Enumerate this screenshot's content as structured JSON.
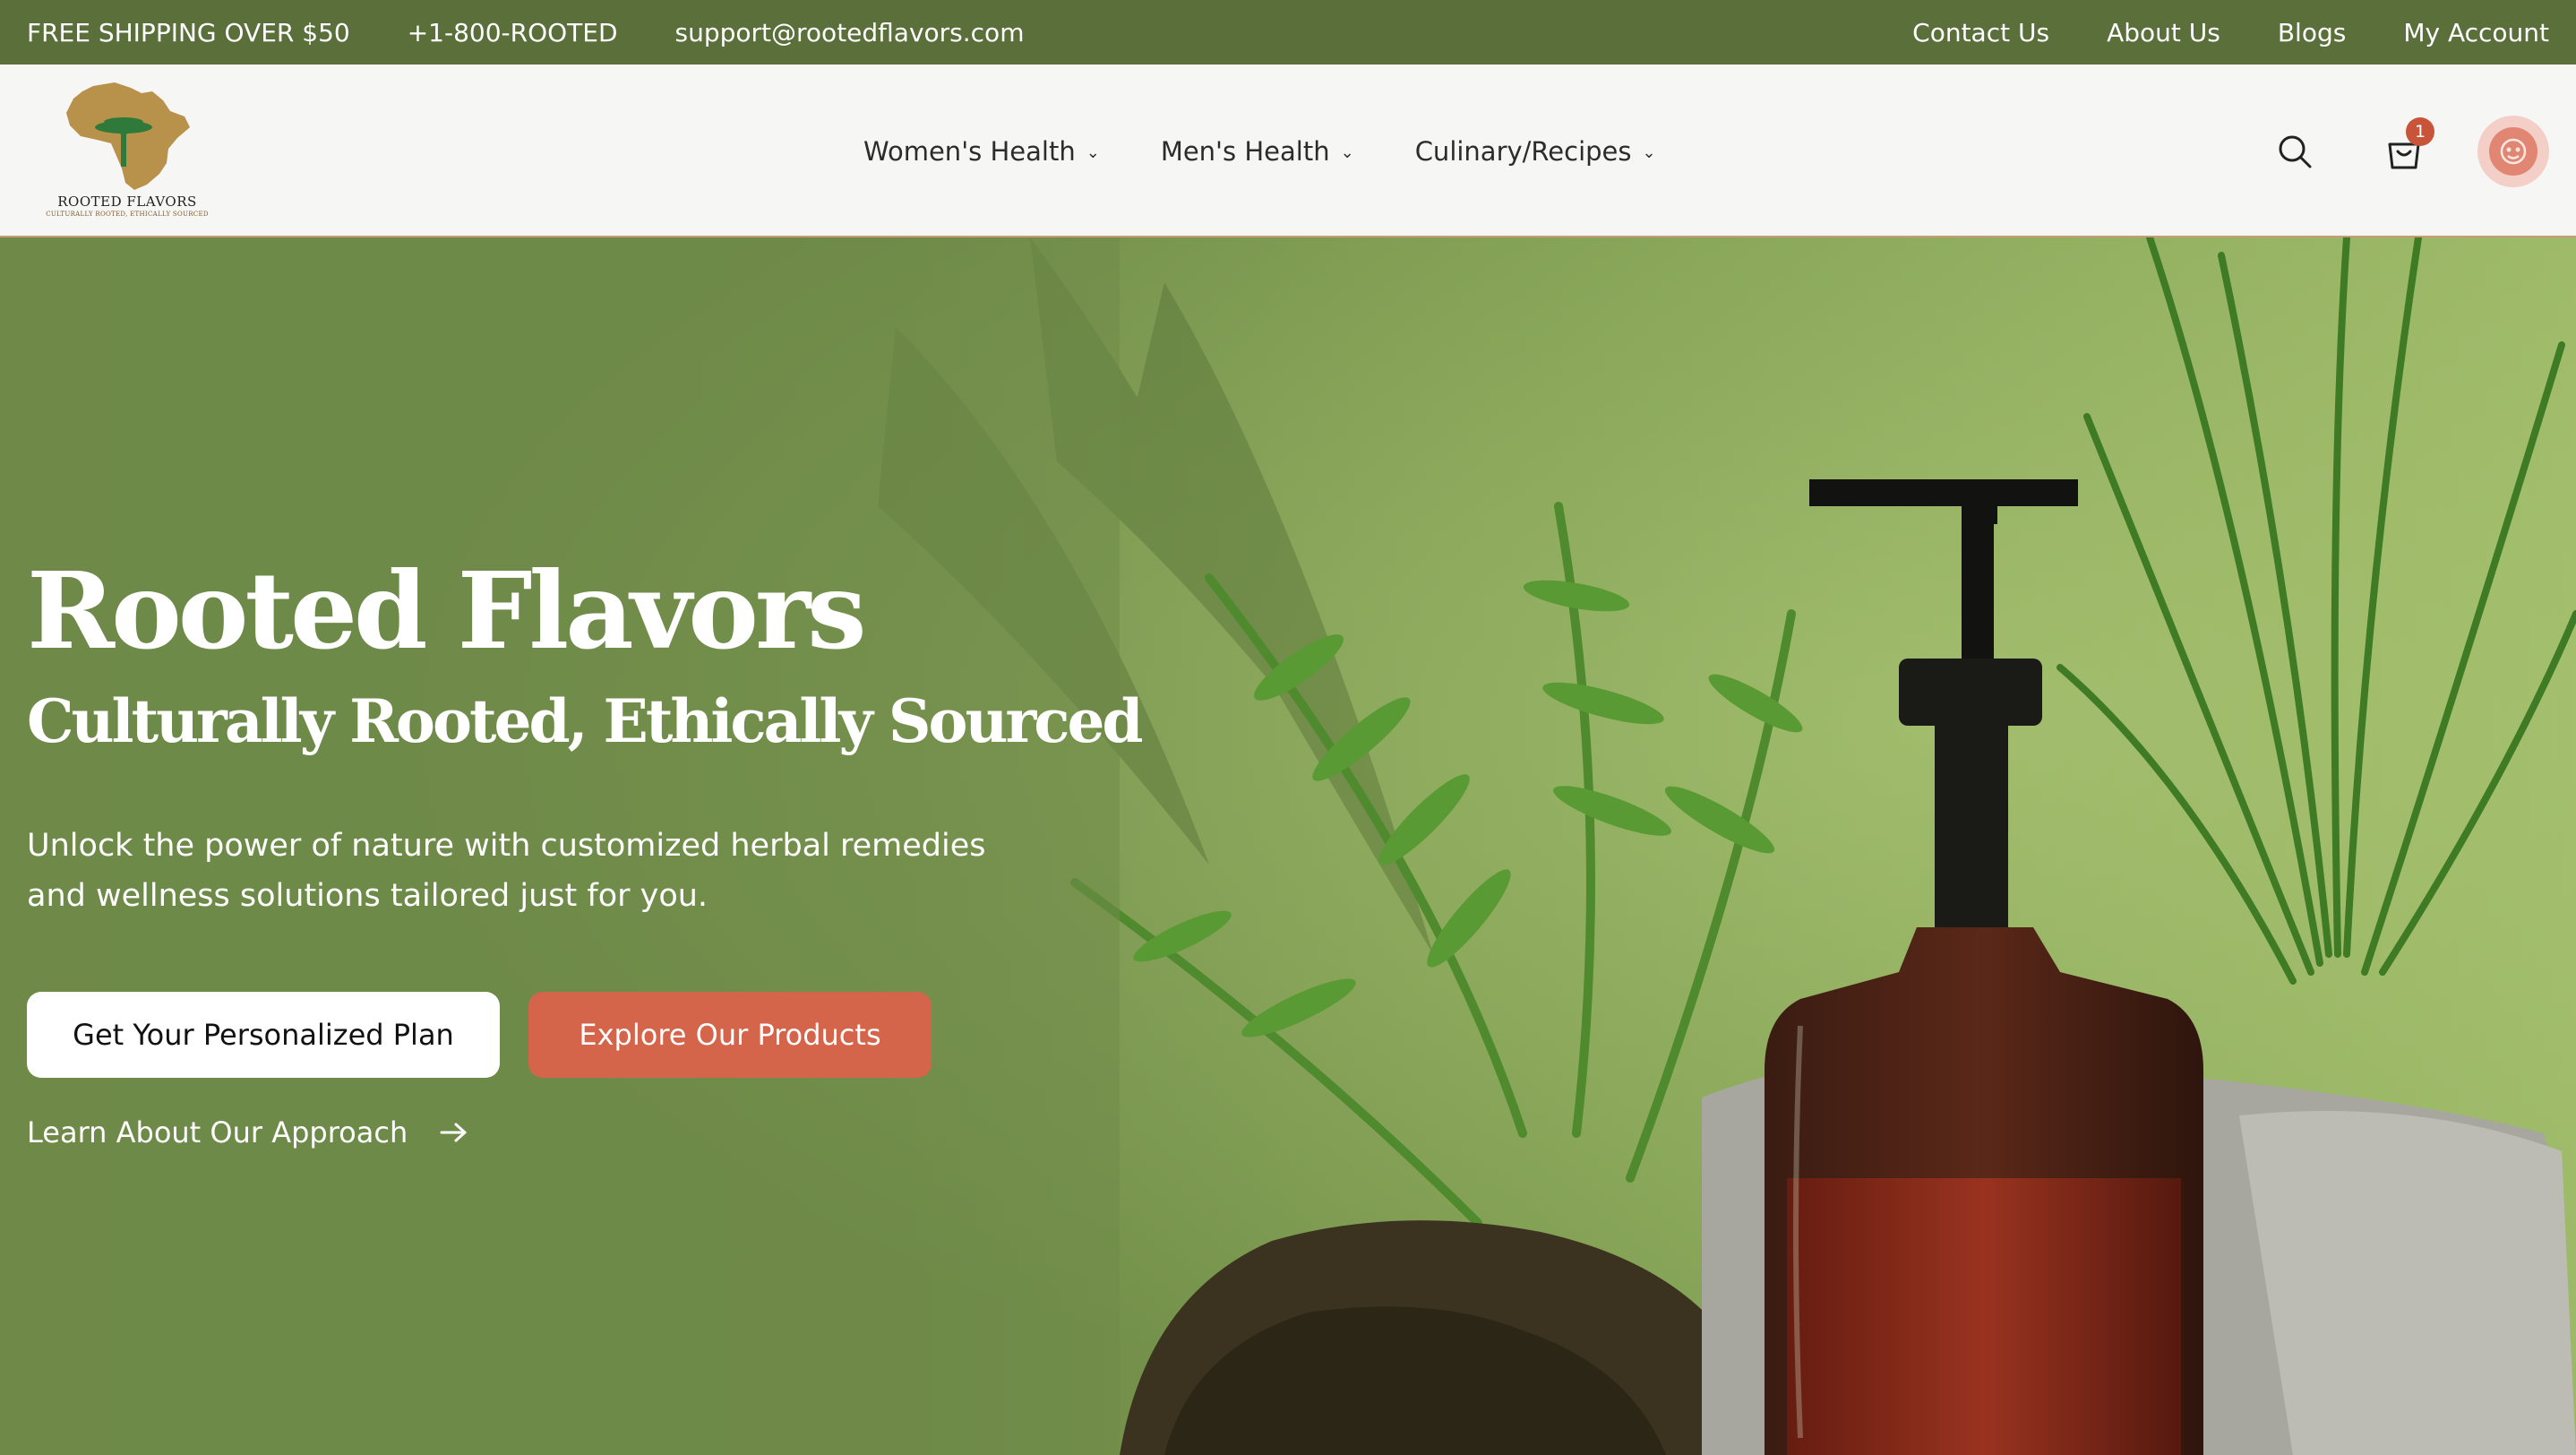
{
  "topbar": {
    "shipping": "FREE SHIPPING OVER $50",
    "phone": "+1-800-ROOTED",
    "email": "support@rootedflavors.com",
    "links": [
      "Contact Us",
      "About Us",
      "Blogs",
      "My Account"
    ]
  },
  "logo": {
    "title": "ROOTED FLAVORS",
    "tagline": "CULTURALLY ROOTED, ETHICALLY SOURCED"
  },
  "nav": {
    "items": [
      "Women's Health",
      "Men's Health",
      "Culinary/Recipes"
    ],
    "chevron_icon": "chevron-down-icon"
  },
  "header_icons": {
    "search": "search-icon",
    "cart": "shopping-bag-icon",
    "cart_count": "1",
    "account": "avatar-icon"
  },
  "hero": {
    "title": "Rooted Flavors",
    "subtitle": "Culturally Rooted, Ethically Sourced",
    "description": "Unlock the power of nature with customized herbal remedies and wellness solutions tailored just for you.",
    "primary_cta": "Get Your Personalized Plan",
    "secondary_cta": "Explore Our Products",
    "link": "Learn About Our Approach"
  },
  "colors": {
    "topbar_bg": "#5a6f3a",
    "header_bg": "#f6f6f5",
    "hero_green": "#6f8b48",
    "accent": "#d4644a",
    "badge": "#c8553a"
  }
}
